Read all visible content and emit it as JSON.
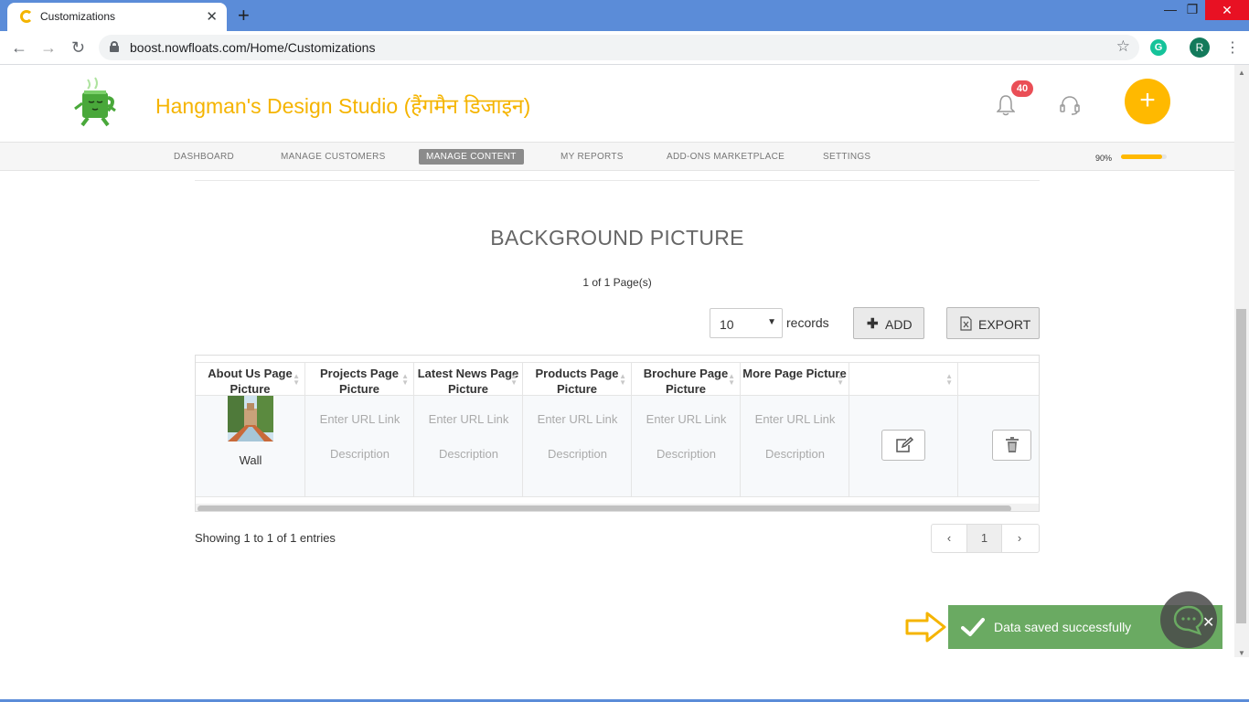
{
  "browser": {
    "tab_title": "Customizations",
    "url": "boost.nowfloats.com/Home/Customizations",
    "profile_initial": "R",
    "extension_initial": "G"
  },
  "header": {
    "brand": "Hangman's Design Studio (हैंगमैन डिजाइन)",
    "notification_count": "40"
  },
  "nav": {
    "items": [
      "DASHBOARD",
      "MANAGE CUSTOMERS",
      "MANAGE CONTENT",
      "MY REPORTS",
      "ADD-ONS MARKETPLACE",
      "SETTINGS"
    ],
    "active": "MANAGE CONTENT",
    "progress_label": "90%",
    "progress_value": 0.9
  },
  "section": {
    "title": "BACKGROUND PICTURE",
    "pages": "1 of 1 Page(s)"
  },
  "controls": {
    "records_value": "10",
    "records_label": "records",
    "add_label": "ADD",
    "export_label": "EXPORT"
  },
  "table": {
    "columns": [
      "About Us Page Picture",
      "Projects Page Picture",
      "Latest News Page Picture",
      "Products Page Picture",
      "Brochure Page Picture",
      "More Page Picture"
    ],
    "row": {
      "about_caption": "Wall",
      "url_placeholder": "Enter URL Link",
      "desc_placeholder": "Description"
    }
  },
  "footer": {
    "showing": "Showing 1 to 1 of 1 entries",
    "current_page": "1"
  },
  "toast": {
    "message": "Data saved successfully"
  },
  "colors": {
    "brand": "#f5b400",
    "toast": "#6aaa62",
    "chrome": "#5b8cd8"
  }
}
